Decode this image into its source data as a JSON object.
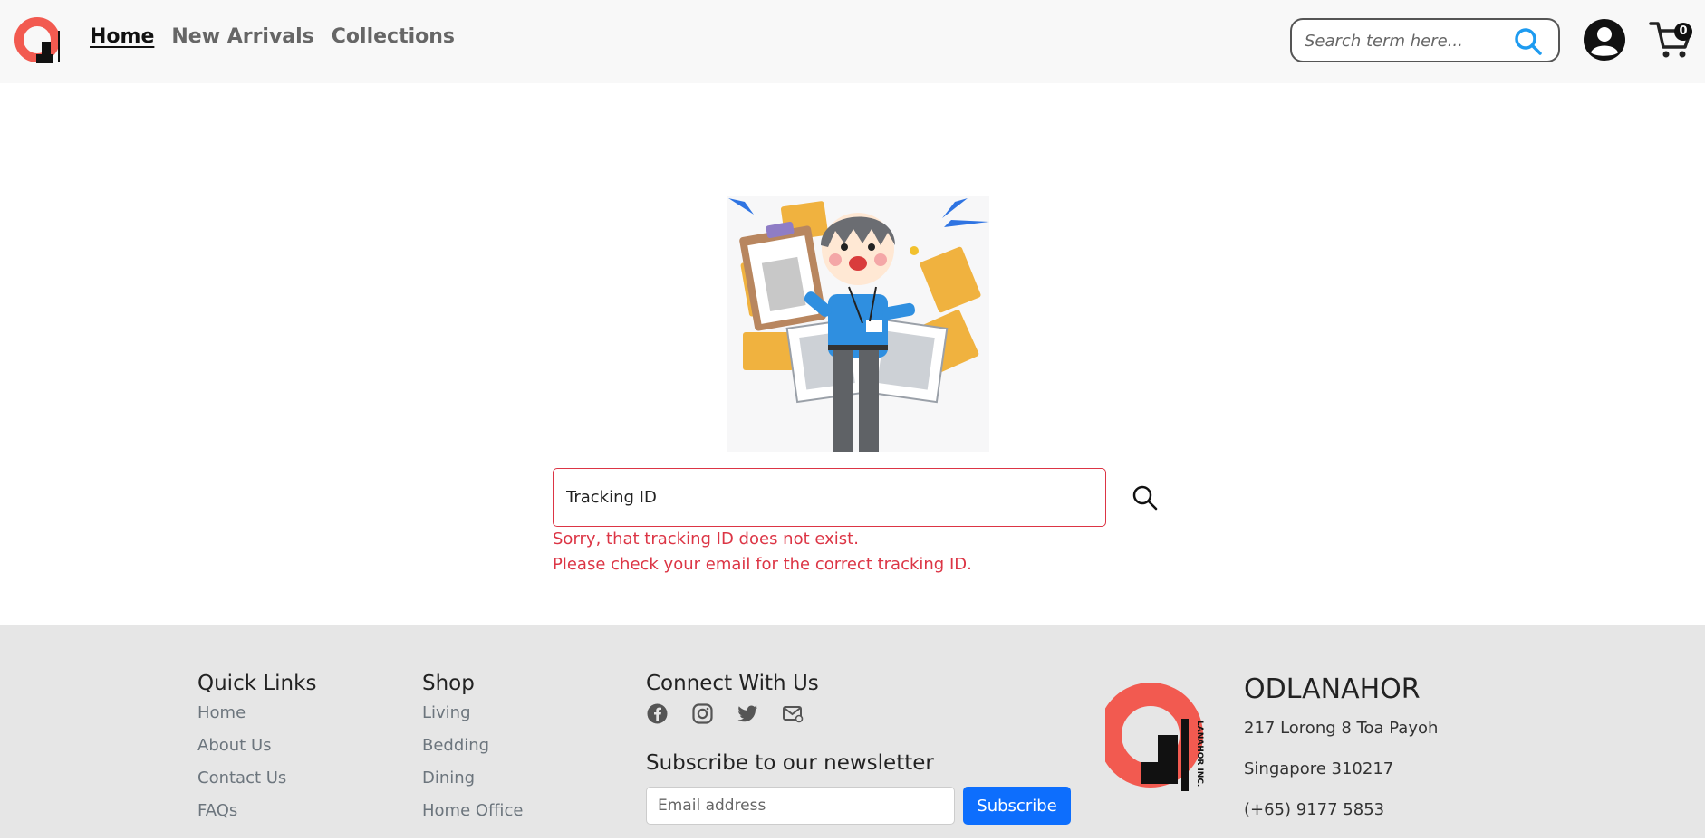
{
  "header": {
    "nav": [
      "Home",
      "New Arrivals",
      "Collections"
    ],
    "search_placeholder": "Search term here...",
    "cart_count": "0"
  },
  "tracking": {
    "input_value": "Tracking ID",
    "error_line1": "Sorry, that tracking ID does not exist.",
    "error_line2": "Please check your email for the correct tracking ID."
  },
  "footer": {
    "quick_links": {
      "title": "Quick Links",
      "items": [
        "Home",
        "About Us",
        "Contact Us",
        "FAQs"
      ]
    },
    "shop": {
      "title": "Shop",
      "items": [
        "Living",
        "Bedding",
        "Dining",
        "Home Office"
      ]
    },
    "connect": {
      "title": "Connect With Us",
      "icons": [
        "facebook-icon",
        "instagram-icon",
        "twitter-icon",
        "email-icon"
      ]
    },
    "newsletter": {
      "title": "Subscribe to our newsletter",
      "placeholder": "Email address",
      "button": "Subscribe"
    },
    "brand": {
      "name": "ODLANAHOR",
      "address1": "217 Lorong 8 Toa Payoh",
      "address2": "Singapore 310217",
      "phone": "(+65) 9177 5853",
      "logo_text": "LANAHOR INC."
    }
  },
  "colors": {
    "logo_red": "#f25a50",
    "error_red": "#dc3545",
    "primary_blue": "#0d6efd",
    "search_icon_blue": "#1e9bf0"
  }
}
